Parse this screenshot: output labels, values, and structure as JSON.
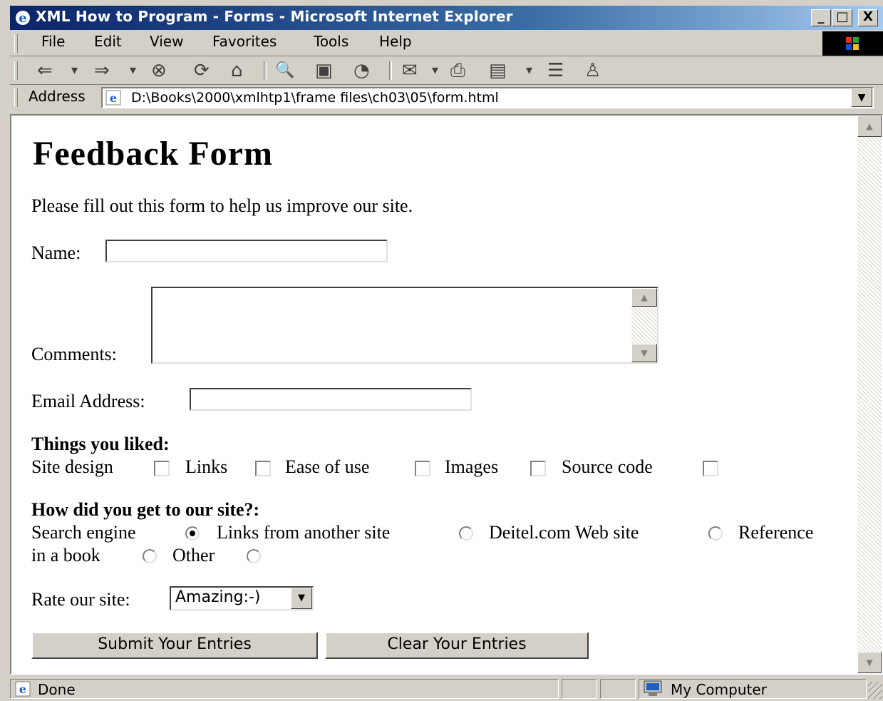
{
  "window": {
    "title": "XML How to Program - Forms - Microsoft Internet Explorer",
    "minimize": "_",
    "maximize": "□",
    "close": "X"
  },
  "menu": [
    "File",
    "Edit",
    "View",
    "Favorites",
    "Tools",
    "Help"
  ],
  "toolbar": {
    "back": "⇐",
    "forward": "⇒",
    "stop": "⊗",
    "refresh": "⟳",
    "home": "⌂",
    "search": "🔍",
    "favorites": "▣",
    "history": "◔",
    "mail": "✉",
    "print": "⎙",
    "edit": "▤",
    "discuss": "☰",
    "messenger": "♙",
    "dropdown": "▾"
  },
  "address": {
    "label": "Address",
    "url": "D:\\Books\\2000\\xmlhtp1\\frame files\\ch03\\05\\form.html",
    "dropdown": "▼"
  },
  "page": {
    "title": "Feedback Form",
    "intro": "Please fill out this form to help us improve our site.",
    "name_label": "Name:",
    "name_value": "",
    "comments_label": "Comments:",
    "comments_value": "",
    "email_label": "Email Address:",
    "email_value": "",
    "liked_heading": "Things you liked:",
    "liked_options": [
      {
        "label": "Site design",
        "checked": false
      },
      {
        "label": "Links",
        "checked": false
      },
      {
        "label": "Ease of use",
        "checked": false
      },
      {
        "label": "Images",
        "checked": false
      },
      {
        "label": "Source code",
        "checked": false
      }
    ],
    "how_heading": "How did you get to our site?:",
    "how_options": [
      {
        "label": "Search engine",
        "checked": true
      },
      {
        "label": "Links from another site",
        "checked": false
      },
      {
        "label": "Deitel.com Web site",
        "checked": false
      },
      {
        "label": "Reference",
        "checked": false
      },
      {
        "label": "in a book",
        "checked": false
      },
      {
        "label": "Other",
        "checked": false
      }
    ],
    "rate_label": "Rate our site:",
    "rate_selected": "Amazing:-)",
    "submit_label": "Submit Your Entries",
    "clear_label": "Clear Your Entries"
  },
  "status": {
    "text": "Done",
    "zone": "My Computer"
  },
  "scroll": {
    "up": "▲",
    "down": "▼"
  }
}
